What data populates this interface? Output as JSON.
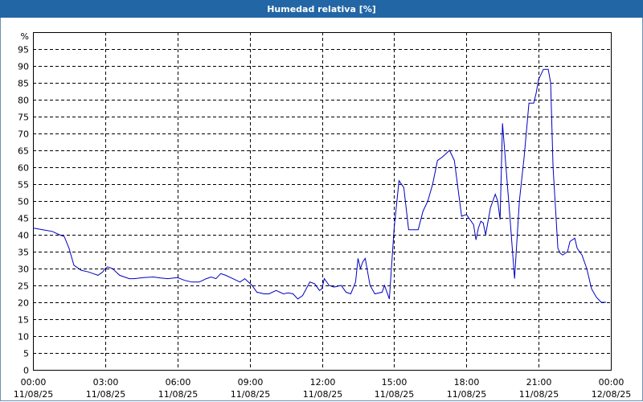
{
  "title": "Humedad relativa [%]",
  "chart_data": {
    "type": "line",
    "title": "Humedad relativa [%]",
    "ylabel": "%",
    "ylim": [
      0,
      100
    ],
    "yticks": [
      0,
      5,
      10,
      15,
      20,
      25,
      30,
      35,
      40,
      45,
      50,
      55,
      60,
      65,
      70,
      75,
      80,
      85,
      90,
      95
    ],
    "xlim": [
      0,
      24
    ],
    "xticks": [
      {
        "x": 0,
        "time": "00:00",
        "date": "11/08/25"
      },
      {
        "x": 3,
        "time": "03:00",
        "date": "11/08/25"
      },
      {
        "x": 6,
        "time": "06:00",
        "date": "11/08/25"
      },
      {
        "x": 9,
        "time": "09:00",
        "date": "11/08/25"
      },
      {
        "x": 12,
        "time": "12:00",
        "date": "11/08/25"
      },
      {
        "x": 15,
        "time": "15:00",
        "date": "11/08/25"
      },
      {
        "x": 18,
        "time": "18:00",
        "date": "11/08/25"
      },
      {
        "x": 21,
        "time": "21:00",
        "date": "11/08/25"
      },
      {
        "x": 24,
        "time": "00:00",
        "date": "12/08/25"
      }
    ],
    "grid": true,
    "line_color": "#0000c0",
    "series": [
      {
        "x": [
          0,
          0.4,
          0.8,
          1.1,
          1.3,
          1.5,
          1.7,
          2.0,
          2.3,
          2.5,
          2.7,
          2.9,
          3.0,
          3.1,
          3.3,
          3.6,
          3.8,
          4.0,
          4.2,
          4.6,
          5.0,
          5.3,
          5.6,
          6.0,
          6.3,
          6.6,
          6.9,
          7.2,
          7.4,
          7.6,
          7.8,
          8.0,
          8.3,
          8.6,
          8.8,
          9.1,
          9.3,
          9.6,
          9.8,
          10.1,
          10.4,
          10.6,
          10.8,
          11.0,
          11.2,
          11.5,
          11.7,
          11.9,
          12.0,
          12.1,
          12.3,
          12.5,
          12.8,
          13.0,
          13.2,
          13.4,
          13.5,
          13.6,
          13.7,
          13.8,
          14.0,
          14.2,
          14.5,
          14.6,
          14.8,
          15.0,
          15.2,
          15.4,
          15.6,
          15.8,
          16.0,
          16.2,
          16.4,
          16.6,
          16.8,
          17.0,
          17.3,
          17.5,
          17.8,
          18.0,
          18.3,
          18.4,
          18.5,
          18.6,
          18.7,
          18.8,
          19.0,
          19.2,
          19.3,
          19.4,
          19.5,
          19.7,
          19.8,
          20.0,
          20.2,
          20.4,
          20.6,
          20.8,
          20.9,
          21.0,
          21.2,
          21.4,
          21.5,
          21.6,
          21.8,
          21.9,
          22.0,
          22.2,
          22.3,
          22.5,
          22.6,
          22.8,
          23.0,
          23.2,
          23.4,
          23.6,
          23.8
        ],
        "y": [
          42,
          41.5,
          41,
          40,
          39.5,
          36,
          31,
          29.5,
          29,
          28.5,
          28,
          29,
          30,
          30.5,
          30,
          28,
          27.5,
          27,
          27,
          27.3,
          27.5,
          27.2,
          27,
          27.3,
          26.5,
          26,
          26,
          27,
          27.5,
          27,
          28.5,
          28,
          27,
          26,
          27,
          25,
          23,
          22.5,
          22.5,
          23.5,
          22.5,
          22.8,
          22.5,
          21,
          22,
          26,
          25.5,
          23.5,
          24,
          27,
          25,
          24.5,
          25,
          23,
          22.5,
          26,
          33,
          30,
          32,
          33,
          25,
          22.5,
          23,
          25,
          21,
          42,
          56,
          54,
          41.5,
          41.5,
          41.5,
          47,
          50,
          55,
          62,
          63,
          65,
          62,
          45.5,
          46,
          43,
          38.5,
          42,
          44,
          43.5,
          40,
          48,
          52,
          50,
          44.5,
          73,
          55,
          46,
          27,
          50,
          63,
          79,
          79,
          82,
          86,
          89,
          89,
          85,
          60,
          36,
          34.5,
          34,
          35,
          38,
          39,
          36,
          34,
          30,
          24,
          21.5,
          20,
          20
        ]
      }
    ]
  }
}
